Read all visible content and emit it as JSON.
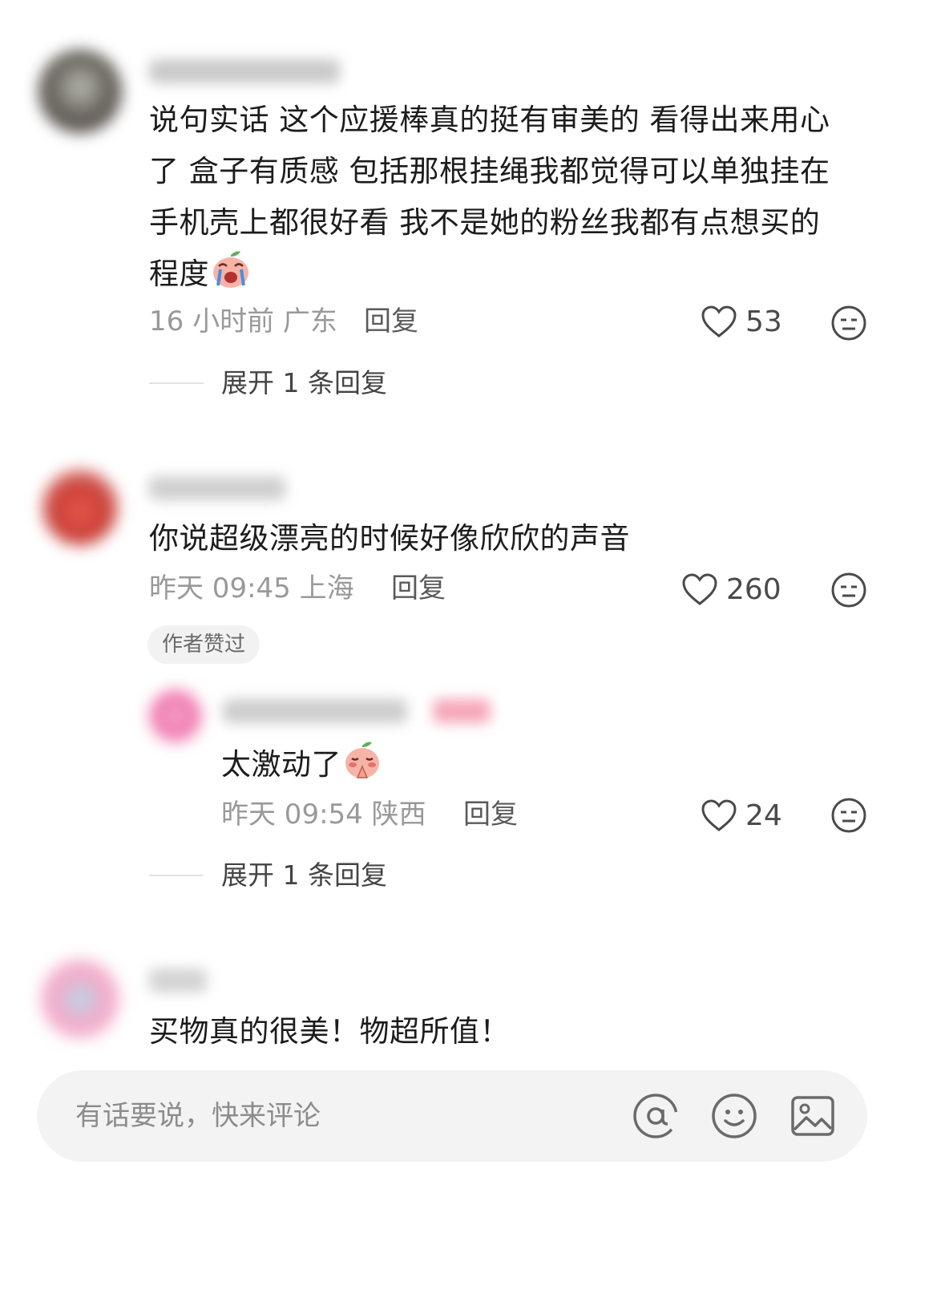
{
  "comments": [
    {
      "text_lines": [
        "说句实话 这个应援棒真的挺有审美的 看得出来用心",
        "了 盒子有质感 包括那根挂绳我都觉得可以单独挂在",
        "手机壳上都很好看 我不是她的粉丝我都有点想买的",
        "程度"
      ],
      "emoji": "crying-face-emoji",
      "meta": "16 小时前  广东",
      "reply_label": "回复",
      "likes": "53",
      "expand_label": "展开 1 条回复"
    },
    {
      "text": "你说超级漂亮的时候好像欣欣的声音",
      "meta": "昨天 09:45 上海",
      "reply_label": "回复",
      "likes": "260",
      "badge": "作者赞过",
      "reply": {
        "text": "太激动了",
        "emoji": "praying-face-emoji",
        "meta": "昨天 09:54 陕西",
        "reply_label": "回复",
        "likes": "24"
      },
      "expand_label": "展开 1 条回复"
    },
    {
      "text": "买物真的很美！物超所值！"
    }
  ],
  "input_bar": {
    "placeholder": "有话要说，快来评论",
    "icons": [
      "at-icon",
      "emoji-icon",
      "image-icon"
    ]
  },
  "colors": {
    "meta_gray": "#999999",
    "input_bg": "#f3f3f3",
    "badge_bg": "#f2f2f2"
  }
}
